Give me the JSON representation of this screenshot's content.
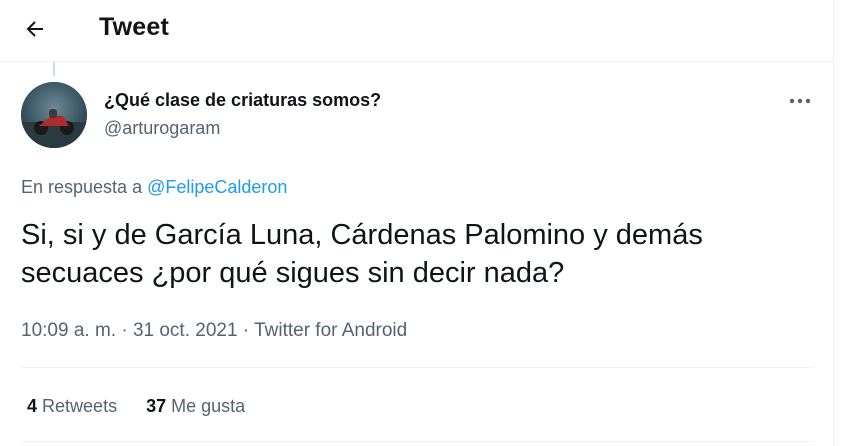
{
  "header": {
    "title": "Tweet",
    "back_icon": "arrow-left-icon"
  },
  "tweet": {
    "author": {
      "display_name": "¿Qué clase de criaturas somos?",
      "handle": "@arturogaram",
      "avatar_icon": "avatar-photo-icon"
    },
    "more_icon": "more-dots-icon",
    "reply_prefix": "En respuesta a",
    "reply_to": "@FelipeCalderon",
    "text_lines": [
      "Si, si y de García Luna, Cárdenas Palomino y demás",
      "secuaces ¿por qué sigues sin decir nada?"
    ],
    "timestamp": "10:09 a. m. · 31 oct. 2021 ·",
    "source": "Twitter for Android",
    "stats": {
      "retweets_count": "4",
      "retweets_label": "Retweets",
      "likes_count": "37",
      "likes_label": "Me gusta"
    }
  },
  "colors": {
    "text": "#0f1419",
    "secondary": "#536471",
    "link": "#1d9bf0",
    "border": "#eff3f4"
  }
}
